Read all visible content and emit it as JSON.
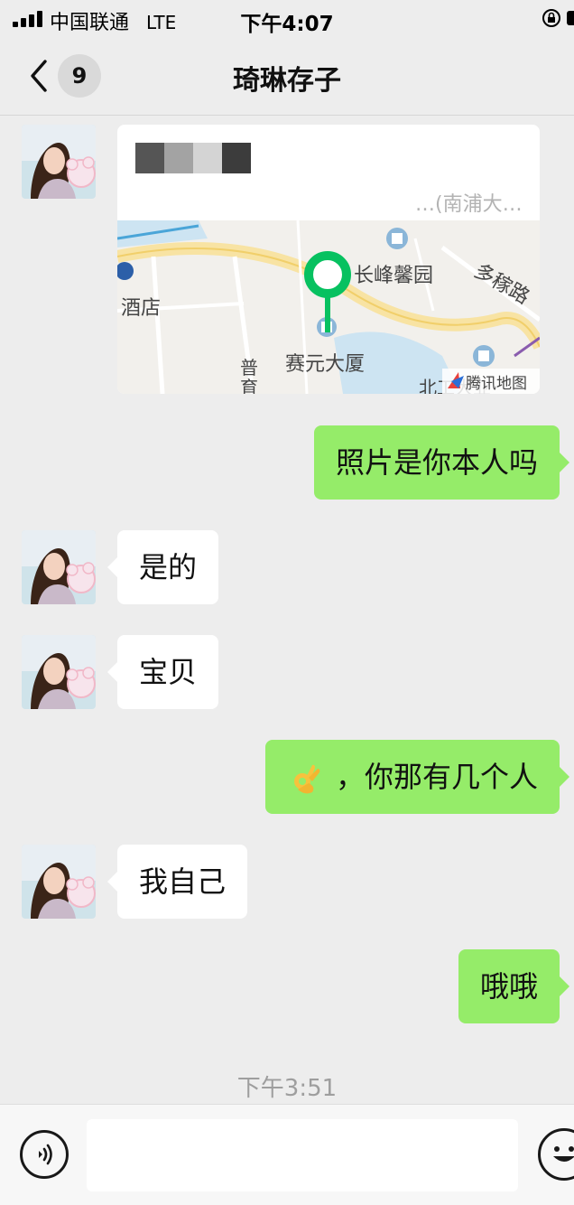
{
  "status_bar": {
    "carrier": "中国联通",
    "network": "LTE",
    "time": "下午4:07"
  },
  "nav": {
    "back_badge": "9",
    "title": "琦琳存子"
  },
  "location_card": {
    "subtitle": "…(南浦大…",
    "map_labels": {
      "poi_1": "长峰馨园",
      "poi_2": "赛元大厦",
      "road_1": "多稼路",
      "poi_3": "酒店",
      "road_2": "普",
      "road_3": "育",
      "poi_4": "北工大业",
      "brand": "腾讯地图"
    }
  },
  "messages": [
    {
      "id": "m1",
      "direction": "outgoing",
      "text": "照片是你本人吗"
    },
    {
      "id": "m2",
      "direction": "incoming",
      "text": "是的"
    },
    {
      "id": "m3",
      "direction": "incoming",
      "text": "宝贝"
    },
    {
      "id": "m4",
      "direction": "outgoing",
      "emoji": "ok-hand",
      "text": "，你那有几个人"
    },
    {
      "id": "m5",
      "direction": "incoming",
      "text": "我自己"
    },
    {
      "id": "m6",
      "direction": "outgoing",
      "text": "哦哦"
    }
  ],
  "time_divider": "下午3:51",
  "input_bar": {
    "value": "",
    "voice_icon": "voice-icon",
    "emoji_icon": "emoji-icon"
  },
  "colors": {
    "background": "#ededed",
    "outgoing_bubble": "#95ec69",
    "incoming_bubble": "#ffffff",
    "map_pin": "#07c160"
  }
}
